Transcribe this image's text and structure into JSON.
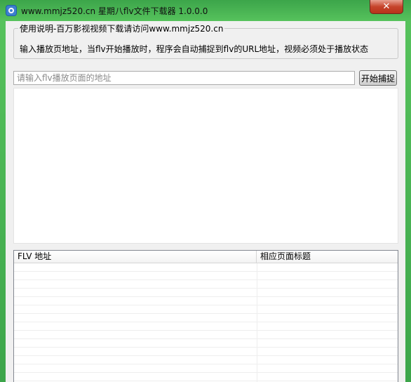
{
  "window": {
    "title": "www.mmjz520.cn 星期八flv文件下载器 1.0.0.0",
    "close_label": "✕"
  },
  "instructions": {
    "legend": "使用说明-百万影视视频下载请访问www.mmjz520.cn",
    "description": "输入播放页地址，当flv开始播放时，程序会自动捕捉到flv的URL地址，视频必须处于播放状态"
  },
  "url_input": {
    "value": "",
    "placeholder": "请输入flv播放页面的地址"
  },
  "start_button": {
    "label": "开始捕捉"
  },
  "results_table": {
    "columns": [
      "FLV 地址",
      "相应页面标题"
    ],
    "rows": []
  }
}
